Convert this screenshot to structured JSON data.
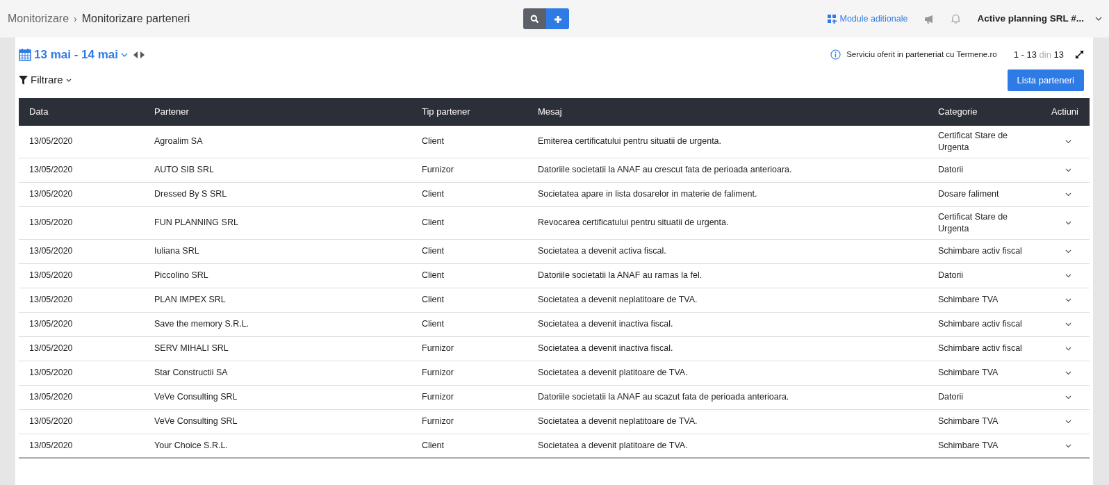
{
  "breadcrumb": [
    "Monitorizare",
    "Monitorizare parteneri"
  ],
  "breadcrumb_separator": "›",
  "header": {
    "modules_link": "Module aditionale",
    "account": "Active planning SRL #..."
  },
  "date_range": "13 mai - 14 mai",
  "filter_label": "Filtrare",
  "service_note": "Serviciu oferit in parteneriat cu Termene.ro",
  "pagination": {
    "range": "1 - 13",
    "of": "din",
    "total": "13"
  },
  "partners_button": "Lista parteneri",
  "table": {
    "columns": [
      "Data",
      "Partener",
      "Tip partener",
      "Mesaj",
      "Categorie",
      "Actiuni"
    ],
    "rows": [
      {
        "date": "13/05/2020",
        "partner": "Agroalim SA",
        "type": "Client",
        "message": "Emiterea certificatului pentru situatii de urgenta.",
        "category": "Certificat Stare de Urgenta"
      },
      {
        "date": "13/05/2020",
        "partner": "AUTO SIB SRL",
        "type": "Furnizor",
        "message": "Datoriile societatii la ANAF au crescut fata de perioada anterioara.",
        "category": "Datorii"
      },
      {
        "date": "13/05/2020",
        "partner": "Dressed By S SRL",
        "type": "Client",
        "message": "Societatea apare in lista dosarelor in materie de faliment.",
        "category": "Dosare faliment"
      },
      {
        "date": "13/05/2020",
        "partner": "FUN PLANNING SRL",
        "type": "Client",
        "message": "Revocarea certificatului pentru situatii de urgenta.",
        "category": "Certificat Stare de Urgenta"
      },
      {
        "date": "13/05/2020",
        "partner": "Iuliana SRL",
        "type": "Client",
        "message": "Societatea a devenit activa fiscal.",
        "category": "Schimbare activ fiscal"
      },
      {
        "date": "13/05/2020",
        "partner": "Piccolino SRL",
        "type": "Client",
        "message": "Datoriile societatii la ANAF au ramas la fel.",
        "category": "Datorii"
      },
      {
        "date": "13/05/2020",
        "partner": "PLAN IMPEX SRL",
        "type": "Client",
        "message": "Societatea a devenit neplatitoare de TVA.",
        "category": "Schimbare TVA"
      },
      {
        "date": "13/05/2020",
        "partner": "Save the memory S.R.L.",
        "type": "Client",
        "message": "Societatea a devenit inactiva fiscal.",
        "category": "Schimbare activ fiscal"
      },
      {
        "date": "13/05/2020",
        "partner": "SERV MIHALI SRL",
        "type": "Furnizor",
        "message": "Societatea a devenit inactiva fiscal.",
        "category": "Schimbare activ fiscal"
      },
      {
        "date": "13/05/2020",
        "partner": "Star Constructii SA",
        "type": "Furnizor",
        "message": "Societatea a devenit platitoare de TVA.",
        "category": "Schimbare TVA"
      },
      {
        "date": "13/05/2020",
        "partner": "VeVe Consulting SRL",
        "type": "Furnizor",
        "message": "Datoriile societatii la ANAF au scazut fata de perioada anterioara.",
        "category": "Datorii"
      },
      {
        "date": "13/05/2020",
        "partner": "VeVe Consulting SRL",
        "type": "Furnizor",
        "message": "Societatea a devenit neplatitoare de TVA.",
        "category": "Schimbare TVA"
      },
      {
        "date": "13/05/2020",
        "partner": "Your Choice S.R.L.",
        "type": "Client",
        "message": "Societatea a devenit platitoare de TVA.",
        "category": "Schimbare TVA"
      }
    ]
  }
}
